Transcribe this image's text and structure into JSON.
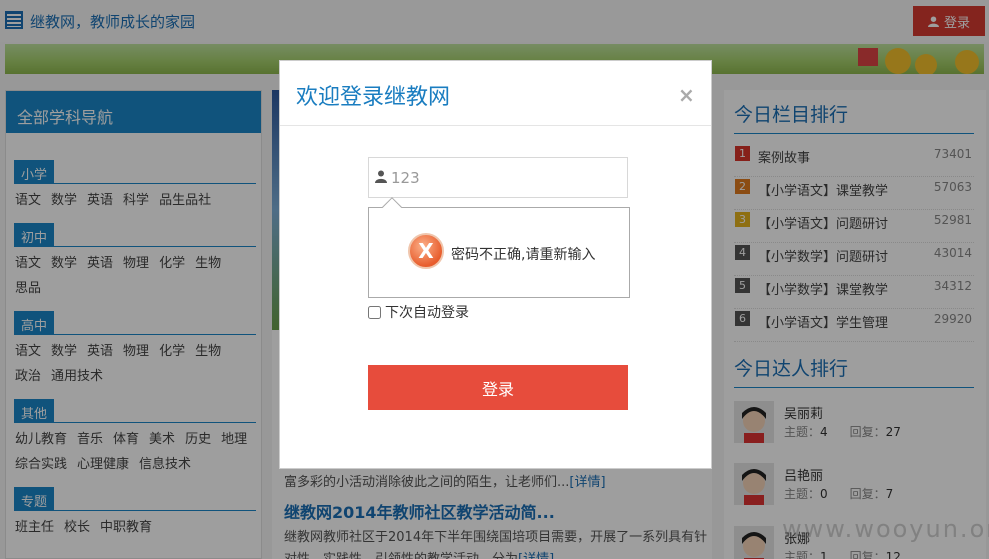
{
  "header": {
    "site_title": "继教网，教师成长的家园",
    "login_label": "登录"
  },
  "leftnav": {
    "title": "全部学科导航",
    "groups": [
      {
        "name": "小学",
        "links": [
          "语文",
          "数学",
          "英语",
          "科学",
          "品生品社"
        ]
      },
      {
        "name": "初中",
        "links": [
          "语文",
          "数学",
          "英语",
          "物理",
          "化学",
          "生物",
          "思品"
        ]
      },
      {
        "name": "高中",
        "links": [
          "语文",
          "数学",
          "英语",
          "物理",
          "化学",
          "生物",
          "政治",
          "通用技术"
        ]
      },
      {
        "name": "其他",
        "links": [
          "幼儿教育",
          "音乐",
          "体育",
          "美术",
          "历史",
          "地理",
          "综合实践",
          "心理健康",
          "信息技术"
        ]
      },
      {
        "name": "专题",
        "links": [
          "班主任",
          "校长",
          "中职教育"
        ]
      }
    ]
  },
  "middle": {
    "line1": "富多彩的小活动消除彼此之间的陌生，让老师们...",
    "detail_label": "[详情]",
    "article_title": "继教网2014年教师社区教学活动简...",
    "article_text": "继教网教师社区于2014年下半年围绕国培项目需要，开展了一系列具有针对性、实践性、引领性的教学活动，分为"
  },
  "ranking": {
    "title": "今日栏目排行",
    "items": [
      {
        "num": "1",
        "name": "案例故事",
        "count": "73401",
        "color": "#d9342b"
      },
      {
        "num": "2",
        "name": "【小学语文】课堂教学",
        "count": "57063",
        "color": "#e07b1f"
      },
      {
        "num": "3",
        "name": "【小学语文】问题研讨",
        "count": "52981",
        "color": "#e6b31e"
      },
      {
        "num": "4",
        "name": "【小学数学】问题研讨",
        "count": "43014",
        "color": "#555555"
      },
      {
        "num": "5",
        "name": "【小学数学】课堂教学",
        "count": "34312",
        "color": "#555555"
      },
      {
        "num": "6",
        "name": "【小学语文】学生管理",
        "count": "29920",
        "color": "#555555"
      }
    ]
  },
  "experts": {
    "title": "今日达人排行",
    "topic_label": "主题：",
    "reply_label": "回复：",
    "users": [
      {
        "name": "吴丽莉",
        "topics": "4",
        "replies": "27"
      },
      {
        "name": "吕艳丽",
        "topics": "0",
        "replies": "7"
      },
      {
        "name": "张娜",
        "topics": "1",
        "replies": "12"
      }
    ]
  },
  "watermark": "www.wooyun.org",
  "modal": {
    "title": "欢迎登录继教网",
    "close_symbol": "×",
    "username_value": "123",
    "error_message": "密码不正确,请重新输入",
    "error_icon_glyph": "X",
    "remember_label": "下次自动登录",
    "submit_label": "登录"
  },
  "colors": {
    "brand_blue": "#1a87c8",
    "login_red": "#d63a31",
    "submit_red": "#e74c3c"
  }
}
